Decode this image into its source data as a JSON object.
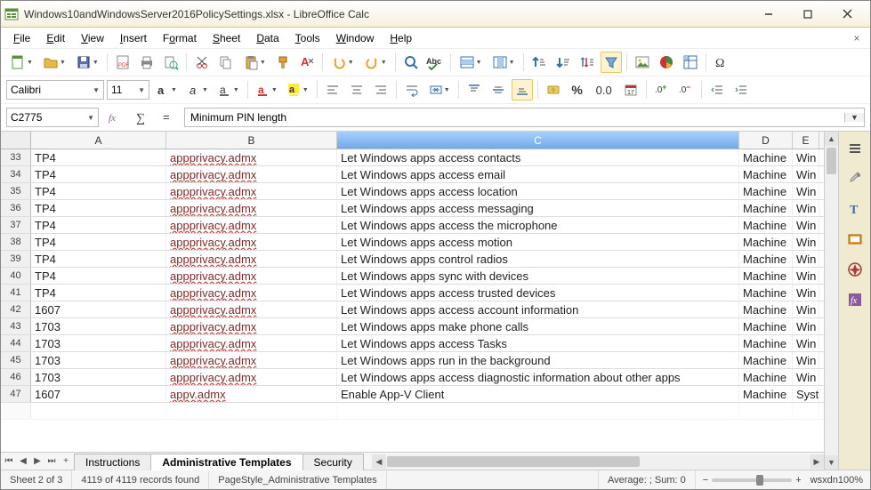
{
  "window": {
    "title": "Windows10andWindowsServer2016PolicySettings.xlsx - LibreOffice Calc"
  },
  "menu": {
    "file": "File",
    "edit": "Edit",
    "view": "View",
    "insert": "Insert",
    "format": "Format",
    "sheet": "Sheet",
    "data": "Data",
    "tools": "Tools",
    "window": "Window",
    "help": "Help"
  },
  "format_bar": {
    "font_name": "Calibri",
    "font_size": "11",
    "percent": "%",
    "numfmt": "0.0"
  },
  "cellref": {
    "name_box": "C2775",
    "formula": "Minimum PIN length"
  },
  "columns": [
    "A",
    "B",
    "C",
    "D",
    "E"
  ],
  "rows": [
    {
      "n": "33",
      "a": "TP4",
      "b": "appprivacy.admx",
      "c": "Let Windows apps access contacts",
      "d": "Machine",
      "e": "Win"
    },
    {
      "n": "34",
      "a": "TP4",
      "b": "appprivacy.admx",
      "c": "Let Windows apps access email",
      "d": "Machine",
      "e": "Win"
    },
    {
      "n": "35",
      "a": "TP4",
      "b": "appprivacy.admx",
      "c": "Let Windows apps access location",
      "d": "Machine",
      "e": "Win"
    },
    {
      "n": "36",
      "a": "TP4",
      "b": "appprivacy.admx",
      "c": "Let Windows apps access messaging",
      "d": "Machine",
      "e": "Win"
    },
    {
      "n": "37",
      "a": "TP4",
      "b": "appprivacy.admx",
      "c": "Let Windows apps access the microphone",
      "d": "Machine",
      "e": "Win"
    },
    {
      "n": "38",
      "a": "TP4",
      "b": "appprivacy.admx",
      "c": "Let Windows apps access motion",
      "d": "Machine",
      "e": "Win"
    },
    {
      "n": "39",
      "a": "TP4",
      "b": "appprivacy.admx",
      "c": "Let Windows apps control radios",
      "d": "Machine",
      "e": "Win"
    },
    {
      "n": "40",
      "a": "TP4",
      "b": "appprivacy.admx",
      "c": "Let Windows apps sync with devices",
      "d": "Machine",
      "e": "Win"
    },
    {
      "n": "41",
      "a": "TP4",
      "b": "appprivacy.admx",
      "c": "Let Windows apps access trusted devices",
      "d": "Machine",
      "e": "Win"
    },
    {
      "n": "42",
      "a": "1607",
      "b": "appprivacy.admx",
      "c": "Let Windows apps access account information",
      "d": "Machine",
      "e": "Win"
    },
    {
      "n": "43",
      "a": "1703",
      "b": "appprivacy.admx",
      "c": "Let Windows apps make phone calls",
      "d": "Machine",
      "e": "Win"
    },
    {
      "n": "44",
      "a": "1703",
      "b": "appprivacy.admx",
      "c": "Let Windows apps access Tasks",
      "d": "Machine",
      "e": "Win"
    },
    {
      "n": "45",
      "a": "1703",
      "b": "appprivacy.admx",
      "c": "Let Windows apps run in the background",
      "d": "Machine",
      "e": "Win"
    },
    {
      "n": "46",
      "a": "1703",
      "b": "appprivacy.admx",
      "c": "Let Windows apps access diagnostic information about other apps",
      "d": "Machine",
      "e": "Win"
    },
    {
      "n": "47",
      "a": "1607",
      "b": "appv.admx",
      "c": "Enable App-V Client",
      "d": "Machine",
      "e": "Syst"
    }
  ],
  "tabs": {
    "t1": "Instructions",
    "t2": "Administrative Templates",
    "t3": "Security"
  },
  "status": {
    "sheet": "Sheet 2 of 3",
    "records": "4119 of 4119 records found",
    "pagestyle": "PageStyle_Administrative Templates",
    "calc": "Average: ; Sum: 0",
    "zoom": "wsxdn100%"
  }
}
